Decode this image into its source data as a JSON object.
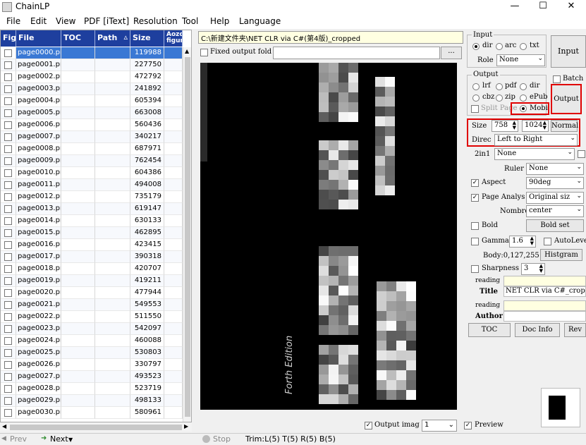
{
  "window": {
    "title": "ChainLP",
    "minimize": "—",
    "maximize": "☐",
    "close": "✕"
  },
  "menu": [
    "File",
    "Edit",
    "View",
    "PDF [iText]",
    "Resolution",
    "Tool",
    "Help",
    "Language"
  ],
  "table": {
    "headers": {
      "fig": "Fig",
      "file": "File",
      "toc": "TOC",
      "path": "Path",
      "size": "Size",
      "aozora": "Aozo figur",
      "sort_arrow": "▵"
    },
    "rows": [
      {
        "file": "page0000.png",
        "size": "119988",
        "selected": true
      },
      {
        "file": "page0001.png",
        "size": "227750"
      },
      {
        "file": "page0002.png",
        "size": "472792"
      },
      {
        "file": "page0003.png",
        "size": "241892"
      },
      {
        "file": "page0004.png",
        "size": "605394"
      },
      {
        "file": "page0005.png",
        "size": "663008"
      },
      {
        "file": "page0006.png",
        "size": "560436"
      },
      {
        "file": "page0007.png",
        "size": "340217"
      },
      {
        "file": "page0008.png",
        "size": "687971"
      },
      {
        "file": "page0009.png",
        "size": "762454"
      },
      {
        "file": "page0010.png",
        "size": "604386"
      },
      {
        "file": "page0011.png",
        "size": "494008"
      },
      {
        "file": "page0012.png",
        "size": "735179"
      },
      {
        "file": "page0013.png",
        "size": "619147"
      },
      {
        "file": "page0014.png",
        "size": "630133"
      },
      {
        "file": "page0015.png",
        "size": "462895"
      },
      {
        "file": "page0016.png",
        "size": "423415"
      },
      {
        "file": "page0017.png",
        "size": "390318"
      },
      {
        "file": "page0018.png",
        "size": "420707"
      },
      {
        "file": "page0019.png",
        "size": "419211"
      },
      {
        "file": "page0020.png",
        "size": "477944"
      },
      {
        "file": "page0021.png",
        "size": "549553"
      },
      {
        "file": "page0022.png",
        "size": "511550"
      },
      {
        "file": "page0023.png",
        "size": "542097"
      },
      {
        "file": "page0024.png",
        "size": "460088"
      },
      {
        "file": "page0025.png",
        "size": "530803"
      },
      {
        "file": "page0026.png",
        "size": "330797"
      },
      {
        "file": "page0027.png",
        "size": "493523"
      },
      {
        "file": "page0028.png",
        "size": "523719"
      },
      {
        "file": "page0029.png",
        "size": "498133"
      },
      {
        "file": "page0030.png",
        "size": "580961"
      }
    ]
  },
  "center": {
    "path": "C:\\新建文件夹\\NET CLR via C#(第4版)_cropped",
    "fixed_output_label": "Fixed output fold",
    "browse": "...",
    "preview_text": "Forth Edition",
    "output_image_label": "Output imag",
    "output_image_value": "1"
  },
  "input_group": {
    "title": "Input",
    "opt_dir": "dir",
    "opt_arc": "arc",
    "opt_txt": "txt",
    "role_label": "Role",
    "role_value": "None",
    "input_button": "Input"
  },
  "output_group": {
    "title": "Output",
    "opt_lrf": "lrf",
    "opt_pdf": "pdf",
    "opt_dir": "dir",
    "opt_cbz": "cbz",
    "opt_zip": "zip",
    "opt_epub": "ePub",
    "split_page": "Split Page",
    "opt_mobi": "Mobi",
    "batch": "Batch",
    "output_button": "Output"
  },
  "size": {
    "label": "Size",
    "width": "758",
    "height": "1024",
    "mode": "Normal"
  },
  "direction": {
    "label": "Direc",
    "value": "Left to Right"
  },
  "two_in_one": {
    "label": "2in1",
    "value": "None"
  },
  "ruler": {
    "label": "Ruler",
    "value": "None"
  },
  "aspect": {
    "label": "Aspect",
    "value": "90deg"
  },
  "page_analysis": {
    "label": "Page Analys",
    "value": "Original siz"
  },
  "nombre": {
    "label": "Nombre",
    "value": "center"
  },
  "bold": {
    "label": "Bold",
    "button": "Bold set"
  },
  "gamma": {
    "label": "Gamma",
    "value": "1.6",
    "autolevel": "AutoLevel"
  },
  "body": {
    "text": "Body:0,127,255",
    "histgram": "Histgram"
  },
  "sharpness": {
    "label": "Sharpness",
    "value": "3"
  },
  "reading1": "reading",
  "title": {
    "label": "Title",
    "value": "NET CLR via C#_cropped"
  },
  "reading2": "reading",
  "author": {
    "label": "Author",
    "value": ""
  },
  "buttons": {
    "toc": "TOC",
    "doc_info": "Doc Info",
    "rev": "Rev"
  },
  "preview_label": "Preview",
  "status": {
    "prev": "Prev",
    "next": "Next",
    "stop": "Stop",
    "trim": "Trim:L(5) T(5) R(5) B(5)"
  },
  "colors": {
    "header_blue": "#1e3f9e",
    "selected_row": "#3a78d4",
    "highlight_red": "#e00000",
    "path_bg": "#ffffe1"
  }
}
